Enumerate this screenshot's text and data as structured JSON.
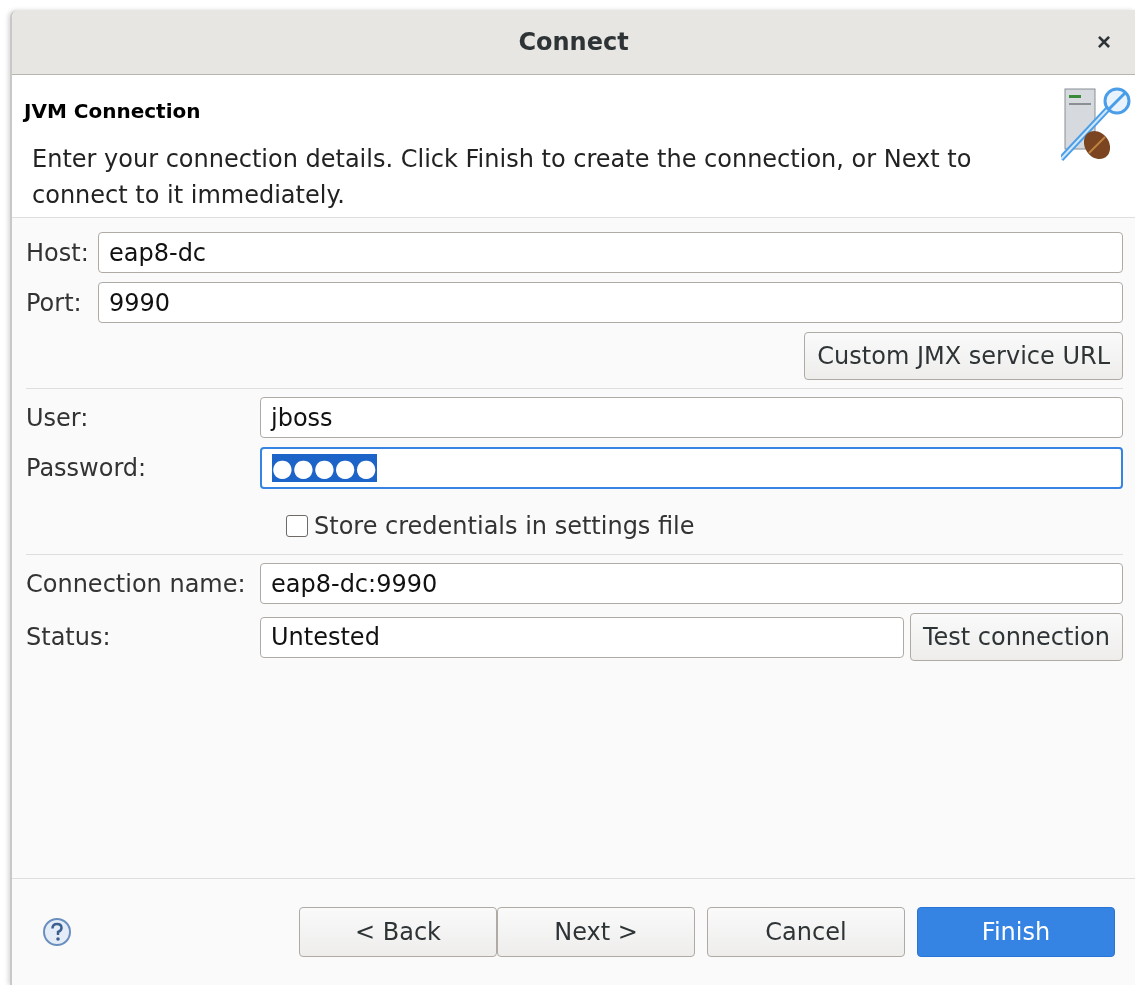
{
  "window": {
    "title": "Connect",
    "close": "×"
  },
  "header": {
    "title": "JVM Connection",
    "description": "Enter your connection details. Click Finish to create the connection, or Next to connect to it immediately."
  },
  "address": {
    "fields": [
      {
        "label": "Host:",
        "value": "eap8-dc"
      },
      {
        "label": "Port:",
        "value": "9990"
      }
    ],
    "button": "Custom JMX service URL"
  },
  "credentials": {
    "fields": [
      {
        "label": "User:",
        "value": "jboss",
        "focused": false,
        "text_selected": false
      },
      {
        "label": "Password:",
        "value": "●●●●●",
        "focused": true,
        "text_selected": true
      }
    ],
    "store": {
      "label": "Store credentials in settings file",
      "checked": false
    }
  },
  "connection": {
    "name_label": "Connection name:",
    "name_value": "eap8-dc:9990",
    "status_label": "Status:",
    "status_value": "Untested",
    "test_button": "Test connection"
  },
  "buttons": [
    {
      "label": "< Back",
      "default": false
    },
    {
      "label": "Next >",
      "default": false
    },
    {
      "label": "Cancel",
      "default": false
    },
    {
      "label": "Finish",
      "default": true
    }
  ]
}
